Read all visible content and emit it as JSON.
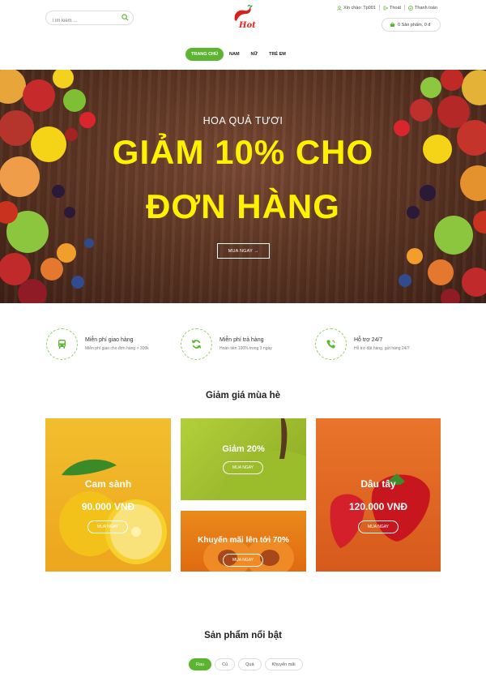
{
  "header": {
    "search_placeholder": "Tìm kiếm ...",
    "logo_text": "Hot",
    "greeting": "Xin chào: Tp001",
    "logout": "Thoát",
    "checkout": "Thanh toán",
    "cart": "0 Sản phẩm, 0 đ"
  },
  "nav": {
    "items": [
      {
        "label": "TRANG CHỦ",
        "active": true
      },
      {
        "label": "NAM"
      },
      {
        "label": "NỮ"
      },
      {
        "label": "TRẺ EM"
      }
    ]
  },
  "banner": {
    "subtitle": "HOA QUẢ TƯƠI",
    "line1": "GIẢM 10% CHO",
    "line2": "ĐƠN HÀNG",
    "button": "MUA NGAY →"
  },
  "services": [
    {
      "icon": "bus-icon",
      "title": "Miễn phí giao hàng",
      "desc": "Miễn phí giao cho đơn hàng > 300k"
    },
    {
      "icon": "refresh-icon",
      "title": "Miễn phí trả hàng",
      "desc": "Hoàn tiền 100% trong 3 ngày"
    },
    {
      "icon": "phone-icon",
      "title": "Hỗ trợ 24/7",
      "desc": "Hỗ trợ đặt hàng, gửi hàng 24/7"
    }
  ],
  "summer_sale": {
    "title": "Giảm giá mùa hè",
    "tiles": [
      {
        "title": "Cam sành",
        "price": "90.000 VNĐ",
        "button": "MUA NGAY"
      },
      {
        "title": "Giảm 20%",
        "button": "MUA NGAY"
      },
      {
        "title": "Khuyến mãi lên tới 70%",
        "button": "MUA NGAY"
      },
      {
        "title": "Dâu tây",
        "price": "120.000 VNĐ",
        "button": "MUA NGAY"
      }
    ]
  },
  "featured": {
    "title": "Sản phẩm nổi bật",
    "tabs": [
      {
        "label": "Rau",
        "active": true
      },
      {
        "label": "Củ"
      },
      {
        "label": "Quả"
      },
      {
        "label": "Khuyến mãi"
      }
    ]
  },
  "colors": {
    "accent": "#5cb531",
    "banner_text": "#fff200",
    "logo_red": "#e8231c"
  }
}
